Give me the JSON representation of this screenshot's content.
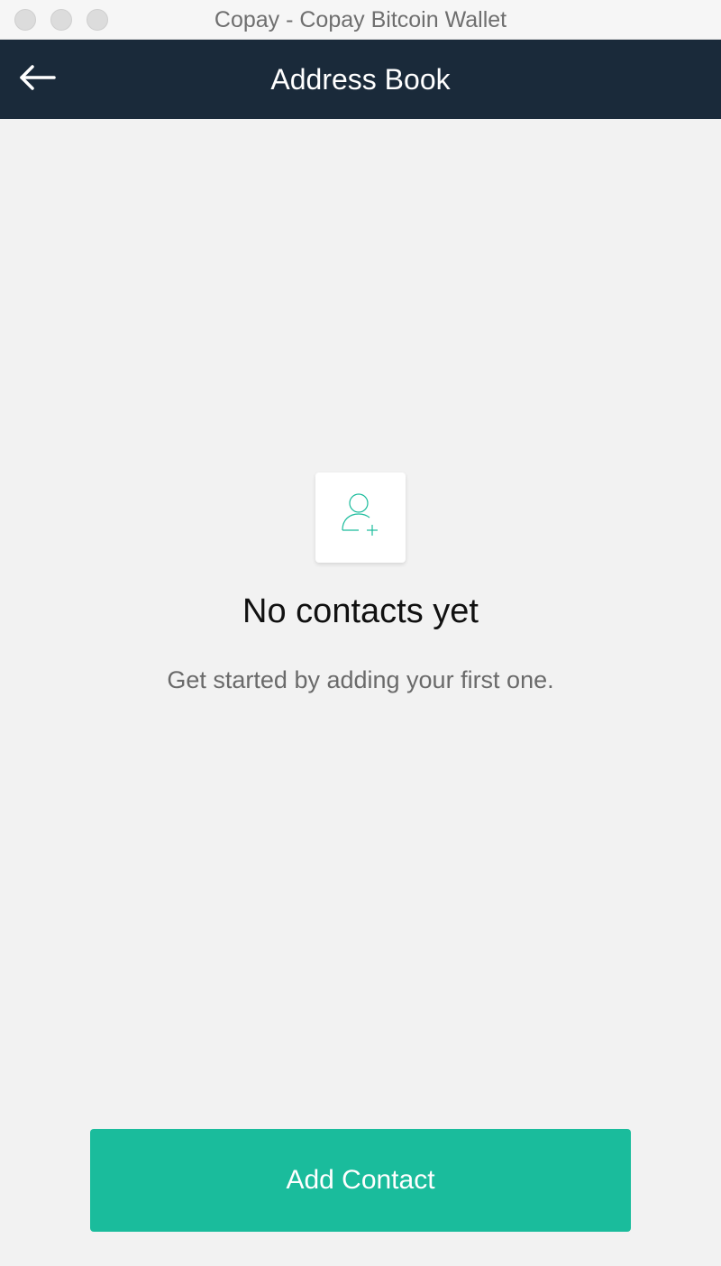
{
  "window": {
    "title": "Copay - Copay Bitcoin Wallet"
  },
  "header": {
    "title": "Address Book",
    "back_icon": "arrow-left-icon"
  },
  "empty_state": {
    "icon": "add-contact-icon",
    "title": "No contacts yet",
    "subtitle": "Get started by adding your first one."
  },
  "actions": {
    "add_contact_label": "Add Contact"
  },
  "colors": {
    "header_bg": "#1a2a3a",
    "accent": "#1abc9c",
    "background": "#f2f2f2"
  }
}
